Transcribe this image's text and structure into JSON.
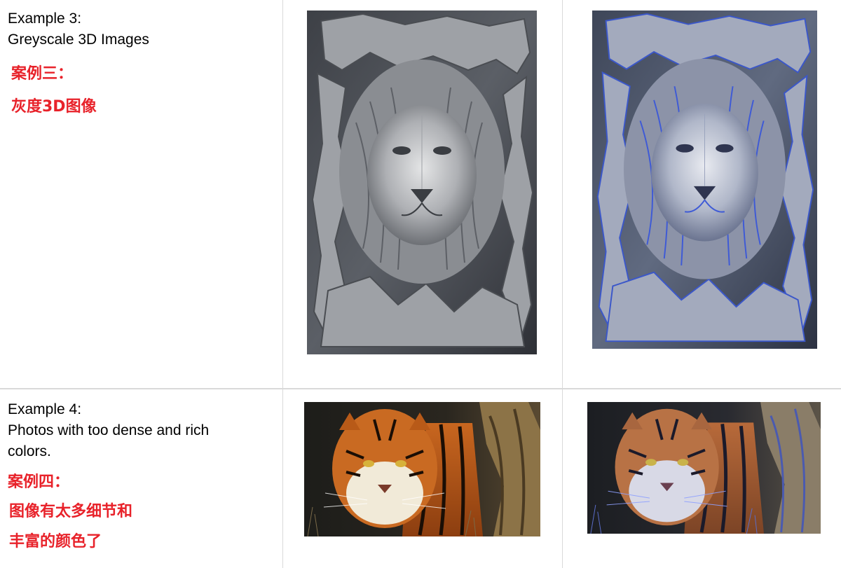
{
  "rows": [
    {
      "example_line1": "Example 3:",
      "example_line2": "Greyscale 3D Images",
      "zh_line1": "案例三：",
      "zh_line2": "灰度3D图像",
      "original_image": "lion-relief-greyscale",
      "processed_image": "lion-relief-blue-tinted"
    },
    {
      "example_line1": "Example 4:",
      "example_line2": "Photos with too dense and rich",
      "example_line3": "colors.",
      "zh_line1": "案例四：",
      "zh_line2": "图像有太多细节和",
      "zh_line3": "丰富的颜色了",
      "original_image": "tiger-photo-color",
      "processed_image": "tiger-photo-processed"
    }
  ],
  "colors": {
    "chinese_text": "#e8222a",
    "grid_lines": "#d9d9d9"
  }
}
